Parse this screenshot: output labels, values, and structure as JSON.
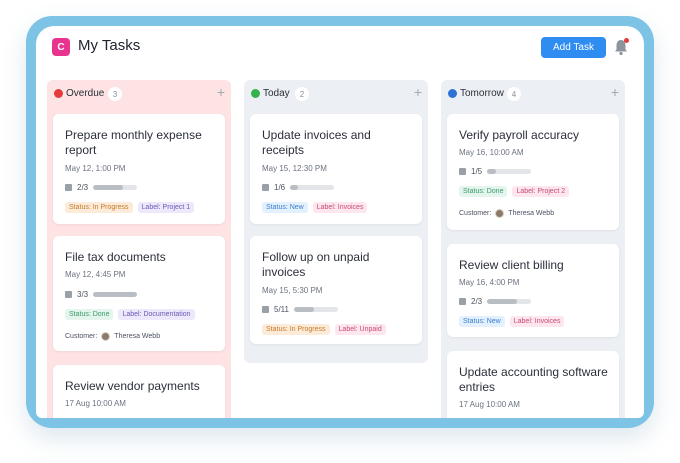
{
  "app": {
    "logo_letter": "C",
    "title": "My Tasks",
    "add_task_label": "Add Task"
  },
  "colors": {
    "overdue": "#e53b3b",
    "today": "#35b24a",
    "tomorrow": "#2f72d6",
    "accent": "#2f8cf0"
  },
  "columns": [
    {
      "name": "Overdue",
      "count": "3",
      "cards": [
        {
          "title": "Prepare monthly expense report",
          "date": "May 12, 1:00 PM",
          "subtasks": "2/3",
          "progress": 0.67,
          "tags": [
            "Status: In Progress",
            "Label: Project 1"
          ]
        },
        {
          "title": "File tax documents",
          "date": "May 12, 4:45 PM",
          "subtasks": "3/3",
          "progress": 1.0,
          "tags": [
            "Status: Done",
            "Label: Documentation"
          ],
          "customer_label": "Customer:",
          "customer": "Theresa Webb"
        },
        {
          "title": "Review vendor payments",
          "date": "17 Aug 10:00 AM"
        }
      ]
    },
    {
      "name": "Today",
      "count": "2",
      "cards": [
        {
          "title": "Update invoices and receipts",
          "date": "May 15, 12:30 PM",
          "subtasks": "1/6",
          "progress": 0.17,
          "tags": [
            "Status: New",
            "Label: Invoices"
          ]
        },
        {
          "title": "Follow up on unpaid invoices",
          "date": "May 15, 5:30 PM",
          "subtasks": "5/11",
          "progress": 0.45,
          "tags": [
            "Status: In Progress",
            "Label: Unpaid"
          ]
        }
      ]
    },
    {
      "name": "Tomorrow",
      "count": "4",
      "cards": [
        {
          "title": "Verify payroll accuracy",
          "date": "May 16, 10:00 AM",
          "subtasks": "1/5",
          "progress": 0.2,
          "tags": [
            "Status: Done",
            "Label: Project 2"
          ],
          "customer_label": "Customer:",
          "customer": "Theresa Webb"
        },
        {
          "title": "Review client billing",
          "date": "May 16, 4:00 PM",
          "subtasks": "2/3",
          "progress": 0.67,
          "tags": [
            "Status: New",
            "Label: Invoices"
          ]
        },
        {
          "title": "Update accounting software entries",
          "date": "17 Aug 10:00 AM"
        }
      ]
    }
  ]
}
